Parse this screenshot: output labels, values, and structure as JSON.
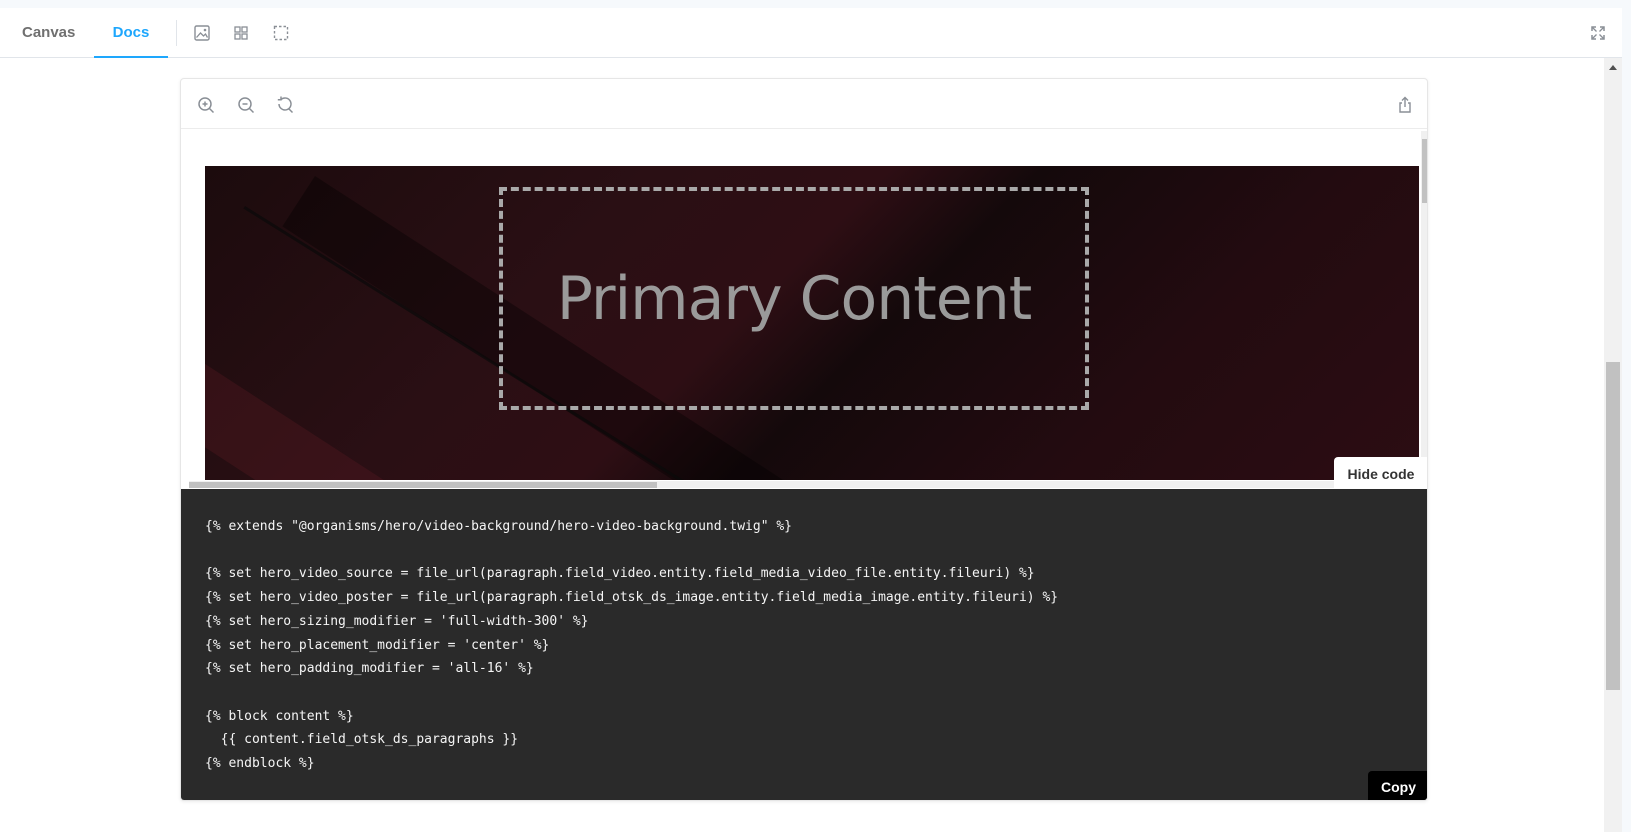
{
  "toolbar": {
    "tabs": [
      {
        "label": "Canvas",
        "active": false
      },
      {
        "label": "Docs",
        "active": true
      }
    ],
    "icons": [
      "image-icon",
      "grid-icon",
      "outline-icon"
    ],
    "right_icon": "fullscreen-icon"
  },
  "preview": {
    "zoom_icons": [
      "zoom-in-icon",
      "zoom-out-icon",
      "zoom-reset-icon"
    ],
    "share_icon": "share-icon",
    "primary_content": "Primary Content",
    "hide_code_label": "Hide code"
  },
  "code": {
    "text": "{% extends \"@organisms/hero/video-background/hero-video-background.twig\" %}\n\n{% set hero_video_source = file_url(paragraph.field_video.entity.field_media_video_file.entity.fileuri) %}\n{% set hero_video_poster = file_url(paragraph.field_otsk_ds_image.entity.field_media_image.entity.fileuri) %}\n{% set hero_sizing_modifier = 'full-width-300' %}\n{% set hero_placement_modifier = 'center' %}\n{% set hero_padding_modifier = 'all-16' %}\n\n{% block content %}\n  {{ content.field_otsk_ds_paragraphs }}\n{% endblock %}",
    "copy_label": "Copy"
  },
  "colors": {
    "accent": "#1ea7fd",
    "code_bg": "#2a2a2a",
    "hero_bg": "#2a0f14"
  }
}
